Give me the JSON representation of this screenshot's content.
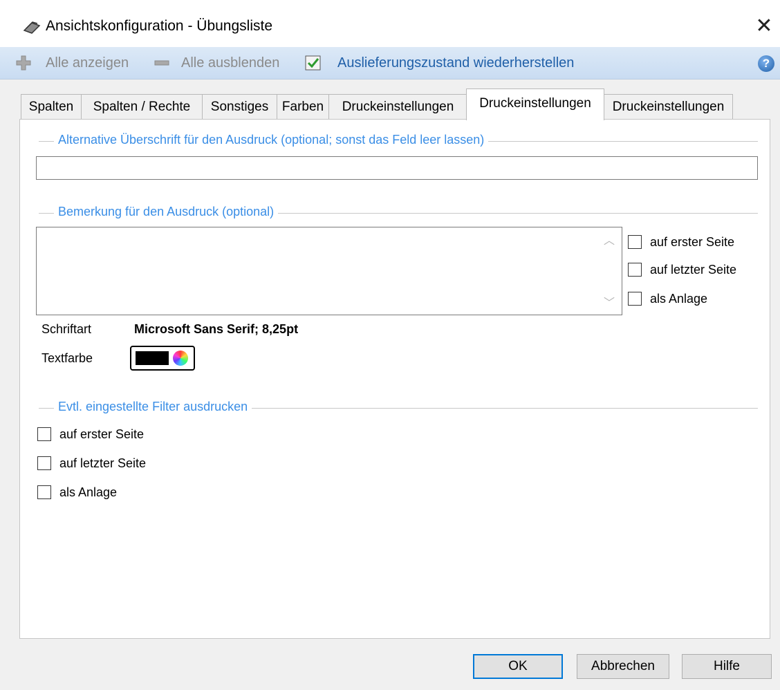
{
  "window": {
    "title": "Ansichtskonfiguration - Übungsliste",
    "close_glyph": "✕"
  },
  "toolbar": {
    "show_all": "Alle anzeigen",
    "hide_all": "Alle ausblenden",
    "restore_default": "Auslieferungszustand wiederherstellen",
    "help_glyph": "?"
  },
  "tabs": [
    {
      "label": "Spalten",
      "active": false
    },
    {
      "label": "Spalten / Rechte",
      "active": false
    },
    {
      "label": "Sonstiges",
      "active": false
    },
    {
      "label": "Farben",
      "active": false
    },
    {
      "label": "Druckeinstellungen",
      "active": false
    },
    {
      "label": "Druckeinstellungen",
      "active": true
    },
    {
      "label": "Druckeinstellungen",
      "active": false
    }
  ],
  "heading_group": {
    "title": "Alternative Überschrift für den Ausdruck (optional; sonst das Feld leer lassen)",
    "value": ""
  },
  "remark_group": {
    "title": "Bemerkung für den Ausdruck (optional)",
    "value": "",
    "options": [
      {
        "label": "auf erster Seite",
        "checked": false
      },
      {
        "label": "auf letzter Seite",
        "checked": false
      },
      {
        "label": "als Anlage",
        "checked": false
      }
    ],
    "font_label": "Schriftart",
    "font_value": "Microsoft Sans Serif; 8,25pt",
    "color_label": "Textfarbe",
    "color_value": "#000000"
  },
  "filter_group": {
    "title": "Evtl. eingestellte Filter ausdrucken",
    "options": [
      {
        "label": "auf erster Seite",
        "checked": false
      },
      {
        "label": "auf letzter Seite",
        "checked": false
      },
      {
        "label": "als Anlage",
        "checked": false
      }
    ]
  },
  "buttons": {
    "ok": "OK",
    "cancel": "Abbrechen",
    "help": "Hilfe"
  },
  "colors": {
    "accent": "#3a8ee6",
    "link": "#1f5fa8",
    "default_button_border": "#0078d7"
  }
}
